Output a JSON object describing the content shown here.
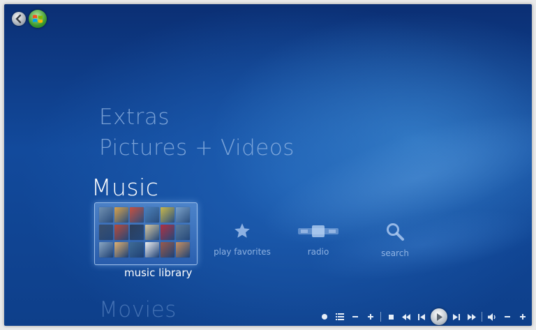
{
  "menu": {
    "categories": [
      {
        "label": "Extras"
      },
      {
        "label": "Pictures + Videos"
      },
      {
        "label": "Music"
      },
      {
        "label": "Movies"
      }
    ],
    "music_strip": {
      "library_label": "music library",
      "items": [
        {
          "label": "play favorites",
          "icon": "star-icon"
        },
        {
          "label": "radio",
          "icon": "radio-icon"
        },
        {
          "label": "search",
          "icon": "magnifier-icon"
        }
      ]
    }
  },
  "album_colors": [
    "#6f8fb0",
    "#d9a24a",
    "#c7503e",
    "#4a7fb8",
    "#c9b84a",
    "#7aa0c8",
    "#3a4f6d",
    "#b84a3a",
    "#2c3e5a",
    "#d8c8a0",
    "#b03040",
    "#5a7a9a",
    "#8aa6c2",
    "#e0b070",
    "#3e6a95",
    "#f0f0f0",
    "#9a5a4a",
    "#c89060"
  ],
  "colors": {
    "accent": "#1e5fb3",
    "text_active": "#ffffff",
    "text_inactive": "#96b9e6"
  },
  "transport_icons": [
    "record-icon",
    "guide-icon",
    "minus-icon",
    "plus-icon",
    "stop-icon",
    "rewind-icon",
    "previous-icon",
    "play-icon",
    "next-icon",
    "fast-forward-icon",
    "volume-icon",
    "minus-icon",
    "plus-icon"
  ]
}
